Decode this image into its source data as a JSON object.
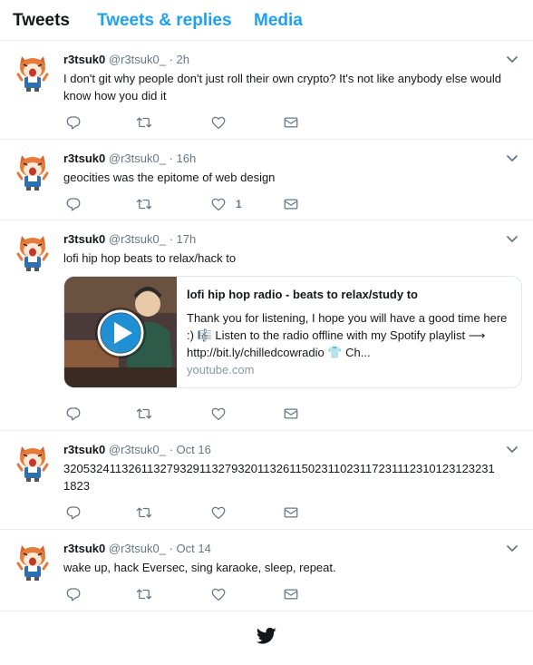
{
  "tabs": [
    {
      "label": "Tweets"
    },
    {
      "label": "Tweets & replies"
    },
    {
      "label": "Media"
    }
  ],
  "user": {
    "name": "r3tsuk0",
    "handle": "@r3tsuk0_"
  },
  "tweets": [
    {
      "time": "2h",
      "text": "I don't git why people don't just roll their own crypto? It's not like anybody else would know how you did it",
      "likes": ""
    },
    {
      "time": "16h",
      "text": "geocities was the epitome of web design",
      "likes": "1"
    },
    {
      "time": "17h",
      "text": "lofi hip hop beats to relax/hack to",
      "likes": ""
    },
    {
      "time": "Oct 16",
      "text": "3205324113261132793291132793201132611502311023117231112310123123231 1823",
      "likes": ""
    },
    {
      "time": "Oct 14",
      "text": "wake up, hack Eversec, sing karaoke, sleep, repeat.",
      "likes": ""
    }
  ],
  "card": {
    "title": "lofi hip hop radio - beats to relax/study to",
    "description": "Thank you for listening, I hope you will have a good time here :) 🎼 Listen to the radio offline with my Spotify playlist ⟶ http://bit.ly/chilledcowradio 👕 Ch...",
    "domain": "youtube.com"
  },
  "icons": {
    "reply": "reply-icon",
    "retweet": "retweet-icon",
    "like": "heart-icon",
    "dm": "envelope-icon",
    "caret": "chevron-down-icon",
    "footer": "twitter-bird-icon"
  },
  "colors": {
    "accent": "#1da1f2",
    "text": "#14171a",
    "muted": "#657786",
    "border": "#e6ecf0"
  }
}
